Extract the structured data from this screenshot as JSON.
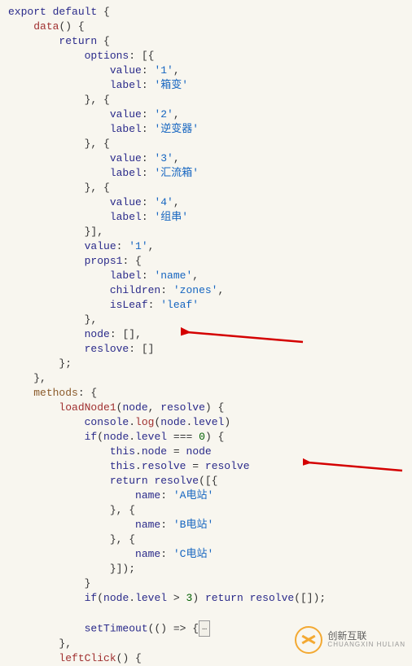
{
  "code": {
    "l1": {
      "export": "export",
      "default": "default",
      "brace": "{"
    },
    "l2": {
      "data": "data",
      "paren": "() {"
    },
    "l3": {
      "return": "return",
      "brace": "{"
    },
    "l4": {
      "options": "options",
      "colon": ": [{"
    },
    "opt1": {
      "valueKey": "value",
      "valueVal": "'1'",
      "labelKey": "label",
      "labelVal": "'箱变'"
    },
    "opt2": {
      "valueKey": "value",
      "valueVal": "'2'",
      "labelKey": "label",
      "labelVal": "'逆变器'"
    },
    "opt3": {
      "valueKey": "value",
      "valueVal": "'3'",
      "labelKey": "label",
      "labelVal": "'汇流箱'"
    },
    "opt4": {
      "valueKey": "value",
      "valueVal": "'4'",
      "labelKey": "label",
      "labelVal": "'组串'"
    },
    "afterOptions": {
      "close": "}],"
    },
    "topValue": {
      "key": "value",
      "val": "'1'"
    },
    "props1": {
      "key": "props1",
      "open": ": {"
    },
    "props1_label": {
      "k": "label",
      "v": "'name'"
    },
    "props1_children": {
      "k": "children",
      "v": "'zones'"
    },
    "props1_isLeaf": {
      "k": "isLeaf",
      "v": "'leaf'"
    },
    "props1_close": "}",
    "node": {
      "k": "node",
      "v": "[]"
    },
    "reslove": {
      "k": "reslove",
      "v": "[]"
    },
    "closeReturn": "};",
    "closeData": "},",
    "methods": {
      "key": "methods",
      "open": ": {"
    },
    "loadNode1": {
      "name": "loadNode1",
      "args": "(node, resolve) {"
    },
    "console": {
      "a": "console",
      "b": "log",
      "c": "node",
      "d": "level"
    },
    "ifLine": {
      "if": "if",
      "node": "node",
      "level": "level",
      "eq": "===",
      "zero": "0",
      "open": ") {"
    },
    "thisNode": {
      "this": "this",
      "node": "node",
      "eq": "=",
      "rhs": "node"
    },
    "thisResolve": {
      "this": "this",
      "resolve": "resolve",
      "eq": "=",
      "rhs": "resolve"
    },
    "returnResolve": {
      "return": "return",
      "resolve": "resolve",
      "open": "([{"
    },
    "nameA": {
      "k": "name",
      "v": "'A电站'"
    },
    "nameB": {
      "k": "name",
      "v": "'B电站'"
    },
    "nameC": {
      "k": "name",
      "v": "'C电站'"
    },
    "closeResolve": "}]);",
    "closeIf": "}",
    "ifLevel3": {
      "if": "if",
      "node": "node",
      "level": "level",
      "gt": ">",
      "three": "3",
      "ret": "return",
      "resolve": "resolve",
      "arg": "([]);"
    },
    "setTimeout": {
      "name": "setTimeout",
      "arrow": "(() => {",
      "box": "…"
    },
    "closeLoad": "},",
    "leftClick": {
      "name": "leftClick",
      "paren": "() {"
    }
  },
  "watermark": {
    "brand": "创新互联",
    "sub": "CHUANGXIN HULIAN"
  }
}
